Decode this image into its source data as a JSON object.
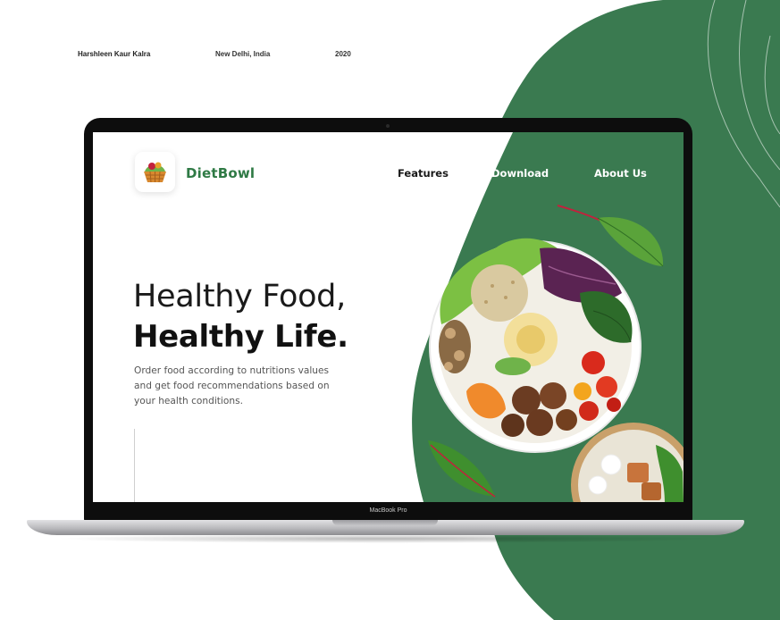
{
  "credits": {
    "author": "Harshleen Kaur Kalra",
    "location": "New Delhi, India",
    "year": "2020"
  },
  "device": {
    "label": "MacBook Pro"
  },
  "site": {
    "brand": "DietBowl",
    "nav": {
      "features": "Features",
      "download": "Download",
      "about": "About Us"
    },
    "hero": {
      "line1": "Healthy Food,",
      "line2": "Healthy Life.",
      "description": "Order food according to nutritions values and get food recommendations based on your health conditions."
    }
  },
  "colors": {
    "brand_green": "#2f7a45",
    "background_green": "#3a7a50",
    "text_dark": "#111111"
  },
  "icons": {
    "logo": "food-basket-icon"
  }
}
